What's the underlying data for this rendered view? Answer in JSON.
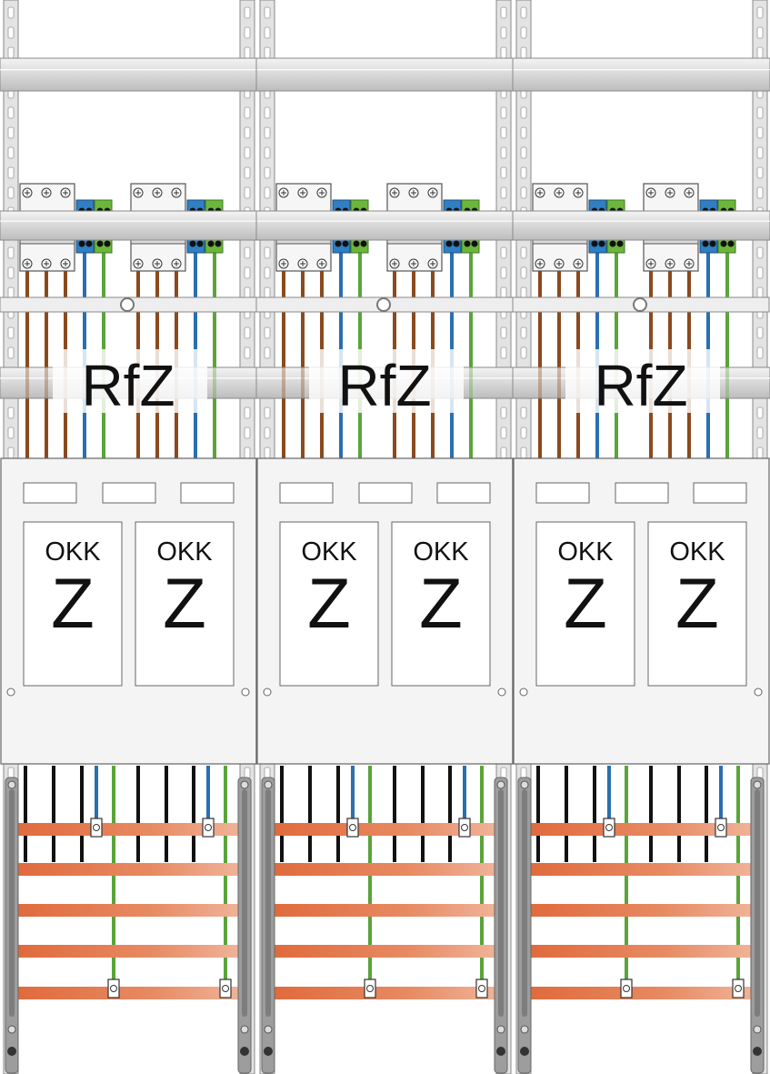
{
  "colors": {
    "background": "#ffffff",
    "rail": "#e3e3e3",
    "rail_edge": "#8a8a8a",
    "phase_wire": "#8a4a1e",
    "neutral_wire": "#2a6fb0",
    "earth_wire": "#5aa43a",
    "black_wire": "#111111",
    "busbar": "#e0784a",
    "terminal_blue": "#2f7fc4",
    "terminal_green": "#6cb63c",
    "panel_border": "#666666"
  },
  "icons": {
    "terminal_screw": "circle-plus",
    "mounting_hole": "circle"
  },
  "sections": [
    {
      "rfz_label": "RfZ",
      "meters": [
        {
          "type": "OKK",
          "letter": "Z"
        },
        {
          "type": "OKK",
          "letter": "Z"
        }
      ]
    },
    {
      "rfz_label": "RfZ",
      "meters": [
        {
          "type": "OKK",
          "letter": "Z"
        },
        {
          "type": "OKK",
          "letter": "Z"
        }
      ]
    },
    {
      "rfz_label": "RfZ",
      "meters": [
        {
          "type": "OKK",
          "letter": "Z"
        },
        {
          "type": "OKK",
          "letter": "Z"
        }
      ]
    }
  ]
}
